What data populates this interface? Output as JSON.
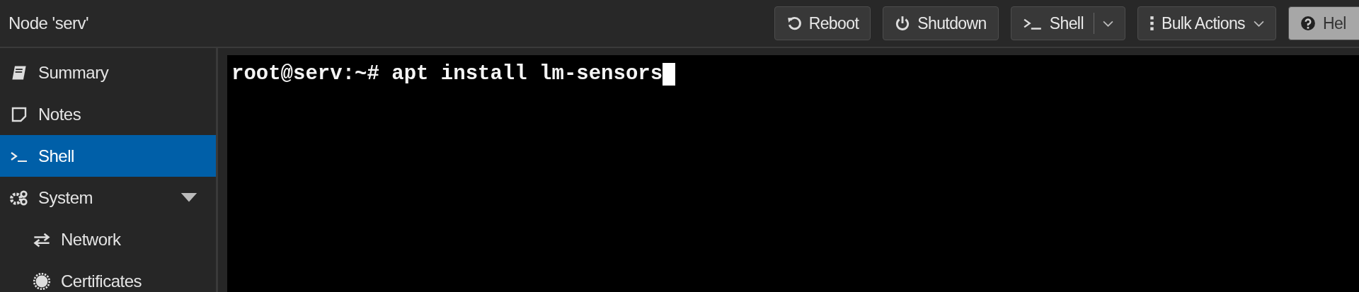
{
  "header": {
    "title": "Node 'serv'"
  },
  "toolbar": [
    {
      "label": "Reboot",
      "kind": "button"
    },
    {
      "label": "Shutdown",
      "kind": "button"
    },
    {
      "label": "Shell",
      "kind": "split"
    },
    {
      "label": "Bulk Actions",
      "kind": "menu"
    },
    {
      "label": "Hel",
      "kind": "light"
    }
  ],
  "sidebar": {
    "items": [
      {
        "label": "Summary",
        "selected": false
      },
      {
        "label": "Notes",
        "selected": false
      },
      {
        "label": "Shell",
        "selected": true
      },
      {
        "label": "System",
        "selected": false,
        "expanded": true,
        "children": [
          {
            "label": "Network",
            "selected": false
          },
          {
            "label": "Certificates",
            "selected": false
          }
        ]
      }
    ]
  },
  "terminal": {
    "lines": [
      "root@serv:~# apt install lm-sensors"
    ]
  }
}
